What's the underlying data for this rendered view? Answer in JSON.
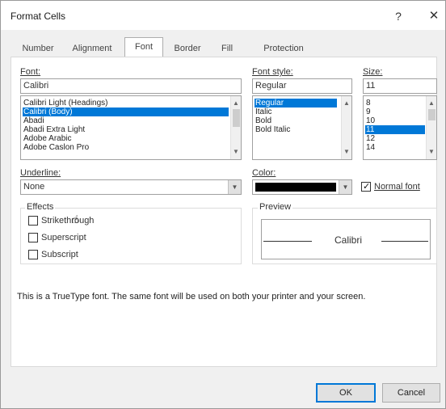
{
  "window": {
    "title": "Format Cells",
    "help_label": "?",
    "close_label": "✕"
  },
  "tabs": [
    "Number",
    "Alignment",
    "Font",
    "Border",
    "Fill",
    "Protection"
  ],
  "font": {
    "label": "Font:",
    "value": "Calibri",
    "list": [
      "Calibri Light (Headings)",
      "Calibri (Body)",
      "Abadi",
      "Abadi Extra Light",
      "Adobe Arabic",
      "Adobe Caslon Pro"
    ],
    "selected_index": 1
  },
  "font_style": {
    "label": "Font style:",
    "value": "Regular",
    "list": [
      "Regular",
      "Italic",
      "Bold",
      "Bold Italic"
    ],
    "selected_index": 0
  },
  "size": {
    "label": "Size:",
    "value": "11",
    "list": [
      "8",
      "9",
      "10",
      "11",
      "12",
      "14"
    ],
    "selected_index": 3
  },
  "underline": {
    "label": "Underline:",
    "value": "None"
  },
  "color": {
    "label": "Color:",
    "swatch": "#000000",
    "normal_font_label": "Normal font",
    "normal_font_checked": true
  },
  "effects": {
    "title": "Effects",
    "items": [
      {
        "label": "Strikethrough",
        "checked": false
      },
      {
        "label": "Superscript",
        "checked": false
      },
      {
        "label": "Subscript",
        "checked": false
      }
    ]
  },
  "preview": {
    "title": "Preview",
    "sample": "Calibri"
  },
  "note": "This is a TrueType font.  The same font will be used on both your printer and your screen.",
  "buttons": {
    "ok": "OK",
    "cancel": "Cancel"
  },
  "colors": {
    "accent": "#0078d7"
  }
}
